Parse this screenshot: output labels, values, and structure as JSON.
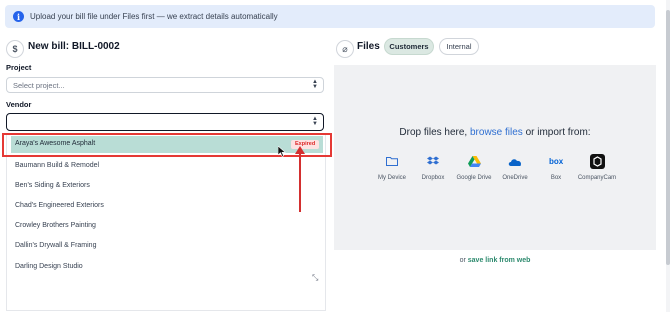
{
  "banner": {
    "icon": "info-icon",
    "text": "Upload your bill file under Files first — we extract details automatically"
  },
  "bill": {
    "icon": "dollar-icon",
    "title": "New bill: BILL-0002"
  },
  "project": {
    "label": "Project",
    "placeholder": "Select project..."
  },
  "vendor": {
    "label": "Vendor",
    "value": "",
    "options": [
      {
        "name": "Araya's Awesome Asphalt",
        "badge": "Expired",
        "highlighted": true
      },
      {
        "name": "Baumann Build & Remodel"
      },
      {
        "name": "Ben's Siding & Exteriors"
      },
      {
        "name": "Chad's Engineered Exteriors"
      },
      {
        "name": "Crowley Brothers Painting"
      },
      {
        "name": "Dallin's Drywall & Framing"
      },
      {
        "name": "Darling Design Studio"
      }
    ]
  },
  "files": {
    "icon": "paperclip-icon",
    "title": "Files",
    "tabs": [
      {
        "label": "Customers",
        "active": true
      },
      {
        "label": "Internal",
        "active": false
      }
    ],
    "drop_prefix": "Drop files here,",
    "drop_link": "browse files",
    "drop_suffix": "or import from:",
    "sources": [
      {
        "name": "My Device",
        "icon": "folder-icon"
      },
      {
        "name": "Dropbox",
        "icon": "dropbox-icon"
      },
      {
        "name": "Google Drive",
        "icon": "google-drive-icon"
      },
      {
        "name": "OneDrive",
        "icon": "onedrive-icon"
      },
      {
        "name": "Box",
        "icon": "box-icon"
      },
      {
        "name": "CompanyCam",
        "icon": "companycam-icon"
      }
    ],
    "save_prefix": "or",
    "save_link": "save link from web"
  },
  "colors": {
    "accent": "#2f6fd1",
    "highlight": "#b9ddd6",
    "annotation": "#e53935",
    "expired": "#dc2626"
  }
}
